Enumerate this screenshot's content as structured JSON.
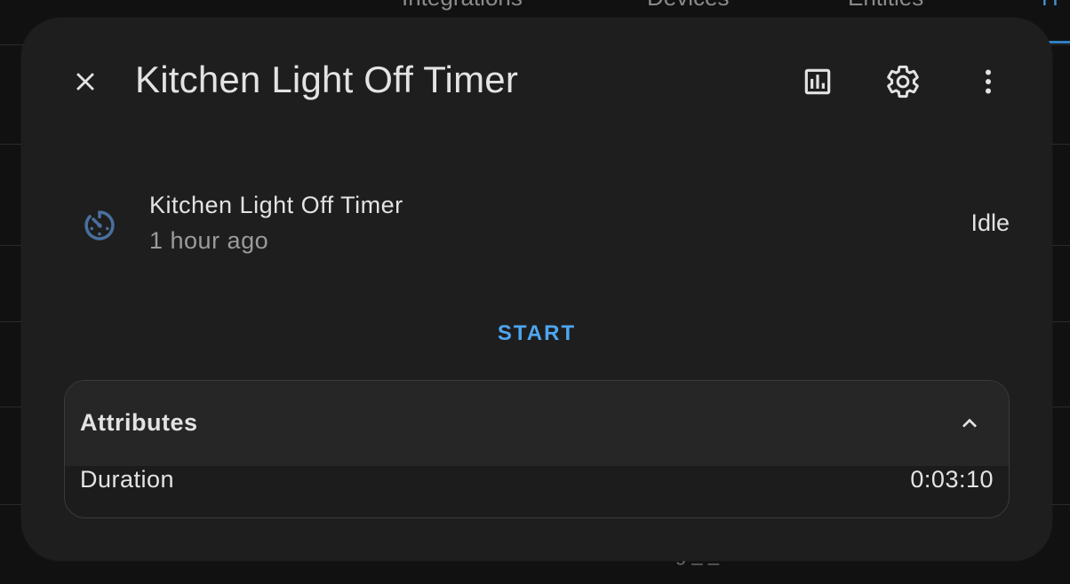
{
  "background": {
    "tabs": [
      "Integrations",
      "Devices",
      "Entities",
      "H"
    ],
    "active_tab_color": "#2f7fc1",
    "footer_fragment": "g _ _"
  },
  "dialog": {
    "title": "Kitchen Light Off Timer",
    "header_icons": [
      "close-icon",
      "history-chart-icon",
      "settings-gear-icon",
      "more-vertical-icon"
    ],
    "entity": {
      "icon": "timer-icon",
      "icon_color": "#4a6f9e",
      "name": "Kitchen Light Off Timer",
      "last_changed": "1 hour ago",
      "state": "Idle"
    },
    "start_label": "START",
    "accent_color": "#4ea6f0",
    "attributes": {
      "title": "Attributes",
      "expanded": true,
      "rows": [
        {
          "key": "Duration",
          "value": "0:03:10"
        }
      ]
    }
  }
}
